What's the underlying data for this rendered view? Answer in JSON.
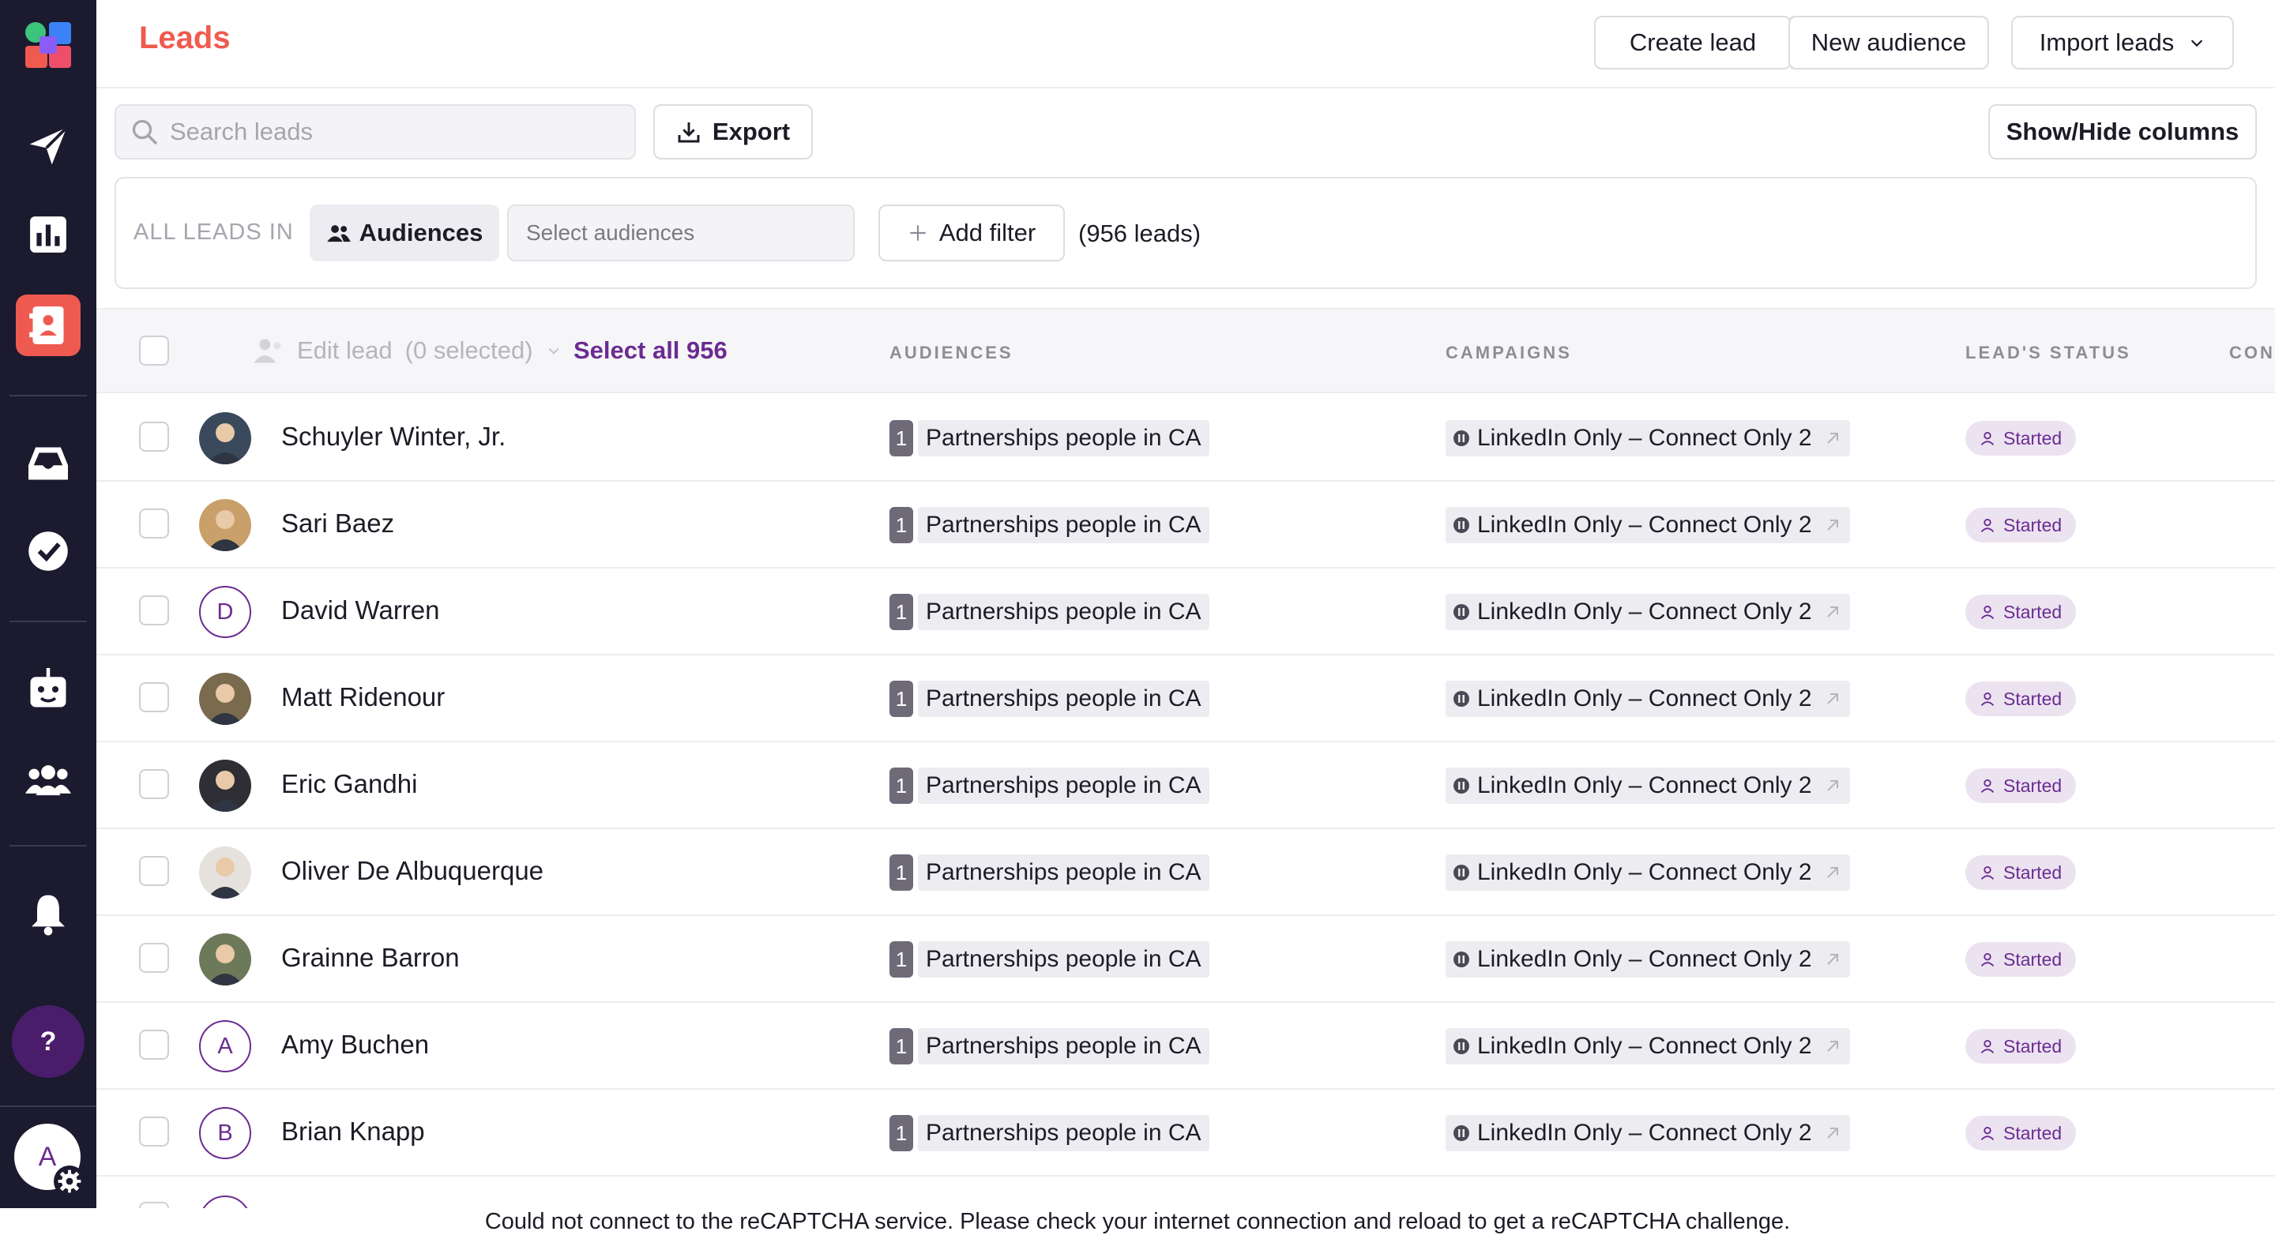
{
  "header": {
    "title": "Leads",
    "create_lead": "Create lead",
    "new_audience": "New audience",
    "import_leads": "Import leads"
  },
  "toolbar": {
    "search_placeholder": "Search leads",
    "export": "Export",
    "show_hide_columns": "Show/Hide columns"
  },
  "filter": {
    "all_leads_in": "ALL LEADS IN",
    "audiences_label": "Audiences",
    "select_audiences_placeholder": "Select audiences",
    "add_filter": "Add filter",
    "lead_count": "(956 leads)"
  },
  "table": {
    "edit_lead": "Edit lead",
    "selected": "(0 selected)",
    "select_all": "Select all 956",
    "columns": [
      "AUDIENCES",
      "CAMPAIGNS",
      "LEAD'S STATUS",
      "CON"
    ],
    "rows": [
      {
        "name": "Schuyler Winter, Jr.",
        "avatar": "photo",
        "audience_count": "1",
        "audience": "Partnerships people in CA",
        "campaign": "LinkedIn Only – Connect Only 2",
        "status": "Started"
      },
      {
        "name": "Sari Baez",
        "avatar": "photo",
        "audience_count": "1",
        "audience": "Partnerships people in CA",
        "campaign": "LinkedIn Only – Connect Only 2",
        "status": "Started"
      },
      {
        "name": "David Warren",
        "avatar": "D",
        "audience_count": "1",
        "audience": "Partnerships people in CA",
        "campaign": "LinkedIn Only – Connect Only 2",
        "status": "Started"
      },
      {
        "name": "Matt Ridenour",
        "avatar": "photo",
        "audience_count": "1",
        "audience": "Partnerships people in CA",
        "campaign": "LinkedIn Only – Connect Only 2",
        "status": "Started"
      },
      {
        "name": "Eric Gandhi",
        "avatar": "photo",
        "audience_count": "1",
        "audience": "Partnerships people in CA",
        "campaign": "LinkedIn Only – Connect Only 2",
        "status": "Started"
      },
      {
        "name": "Oliver De Albuquerque",
        "avatar": "photo",
        "audience_count": "1",
        "audience": "Partnerships people in CA",
        "campaign": "LinkedIn Only – Connect Only 2",
        "status": "Started"
      },
      {
        "name": "Grainne Barron",
        "avatar": "photo",
        "audience_count": "1",
        "audience": "Partnerships people in CA",
        "campaign": "LinkedIn Only – Connect Only 2",
        "status": "Started"
      },
      {
        "name": "Amy Buchen",
        "avatar": "A",
        "audience_count": "1",
        "audience": "Partnerships people in CA",
        "campaign": "LinkedIn Only – Connect Only 2",
        "status": "Started"
      },
      {
        "name": "Brian Knapp",
        "avatar": "B",
        "audience_count": "1",
        "audience": "Partnerships people in CA",
        "campaign": "LinkedIn Only – Connect Only 2",
        "status": "Started"
      }
    ]
  },
  "sidebar": {
    "help": "?",
    "user_initial": "A",
    "icons": [
      "logo-icon",
      "send-icon",
      "analytics-icon",
      "contacts-icon",
      "inbox-icon",
      "tasks-icon",
      "bot-icon",
      "team-icon",
      "bell-icon"
    ]
  },
  "footer": {
    "recaptcha_error": "Could not connect to the reCAPTCHA service. Please check your internet connection and reload to get a reCAPTCHA challenge."
  },
  "colors": {
    "brand_coral": "#f05a4f",
    "brand_purple": "#6b2c91",
    "sidebar_bg": "#1b1a2e",
    "status_bg": "#ece3f1"
  }
}
